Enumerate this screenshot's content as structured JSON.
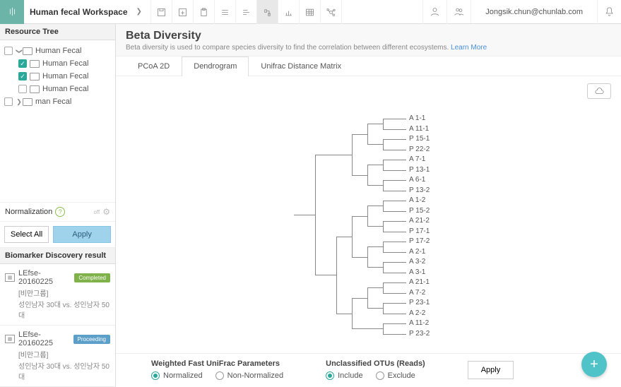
{
  "header": {
    "workspace_name": "Human fecal Workspace",
    "user_email": "Jongsik.chun@chunlab.com"
  },
  "sidebar": {
    "resource_tree_label": "Resource Tree",
    "tree": {
      "root_label": "Human Fecal",
      "children": [
        {
          "label": "Human Fecal",
          "checked": true
        },
        {
          "label": "Human Fecal",
          "checked": true
        },
        {
          "label": "Human Fecal",
          "checked": false
        }
      ],
      "sibling_label": "man Fecal"
    },
    "normalization_label": "Normalization",
    "normalization_state": "off",
    "select_all_label": "Select All",
    "apply_label": "Apply",
    "biomarker_header": "Biomarker Discovery result",
    "biomarker_items": [
      {
        "name": "LEfse-20160225",
        "status_label": "Completed",
        "status": "completed",
        "group": "[비만그룹]",
        "detail": "성인남자 30대 vs. 성인남자 50대"
      },
      {
        "name": "LEfse-20160225",
        "status_label": "Proceeding",
        "status": "proceeding",
        "group": "[비만그룹]",
        "detail": "성인남자 30대 vs. 성인남자 50대"
      }
    ]
  },
  "content": {
    "title": "Beta Diversity",
    "description": "Beta diversity is used to compare species diversity to find the correlation between different ecosystems.",
    "learn_more": "Learn More",
    "tabs": [
      {
        "label": "PCoA 2D",
        "active": false
      },
      {
        "label": "Dendrogram",
        "active": true
      },
      {
        "label": "Unifrac Distance Matrix",
        "active": false
      }
    ]
  },
  "bottom": {
    "param1_title": "Weighted Fast UniFrac Parameters",
    "param1_options": [
      "Normalized",
      "Non-Normalized"
    ],
    "param1_selected": 0,
    "param2_title": "Unclassified OTUs (Reads)",
    "param2_options": [
      "Include",
      "Exclude"
    ],
    "param2_selected": 0,
    "apply_label": "Apply"
  },
  "chart_data": {
    "type": "dendrogram",
    "leaves": [
      "A 1-1",
      "A 11-1",
      "P 15-1",
      "P 22-2",
      "A 7-1",
      "P 13-1",
      "A 6-1",
      "P 13-2",
      "A 1-2",
      "P 15-2",
      "A 21-2",
      "P 17-1",
      "P 17-2",
      "A 2-1",
      "A 3-2",
      "A 3-1",
      "A 21-1",
      "A 7-2",
      "P 23-1",
      "A 2-2",
      "A 11-2",
      "P 23-2"
    ],
    "cluster1_count": 8,
    "cluster2_count": 14
  }
}
